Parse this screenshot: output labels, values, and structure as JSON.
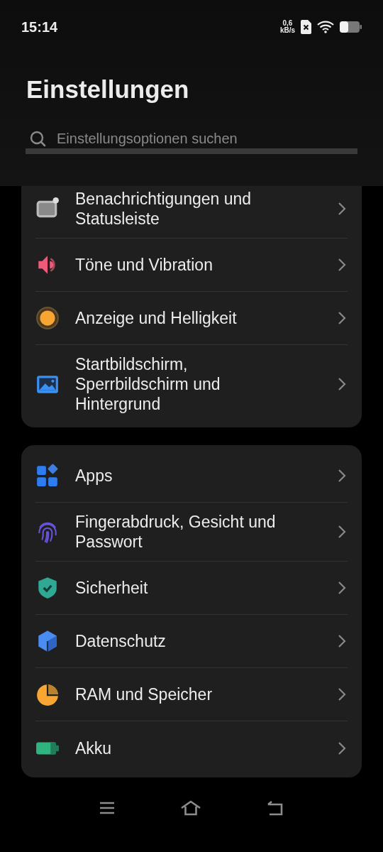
{
  "status_bar": {
    "time": "15:14",
    "net_speed_value": "0,6",
    "net_speed_unit": "kB/s"
  },
  "title": "Einstellungen",
  "search": {
    "placeholder": "Einstellungsoptionen suchen"
  },
  "groups": [
    {
      "items": [
        {
          "label": "Benachrichtigungen und Statusleiste"
        },
        {
          "label": "Töne und Vibration"
        },
        {
          "label": "Anzeige und Helligkeit"
        },
        {
          "label": "Startbildschirm, Sperrbildschirm und Hintergrund"
        }
      ]
    },
    {
      "items": [
        {
          "label": "Apps"
        },
        {
          "label": "Fingerabdruck, Gesicht und Passwort"
        },
        {
          "label": "Sicherheit"
        },
        {
          "label": "Datenschutz"
        },
        {
          "label": "RAM und Speicher"
        },
        {
          "label": "Akku"
        }
      ]
    }
  ]
}
